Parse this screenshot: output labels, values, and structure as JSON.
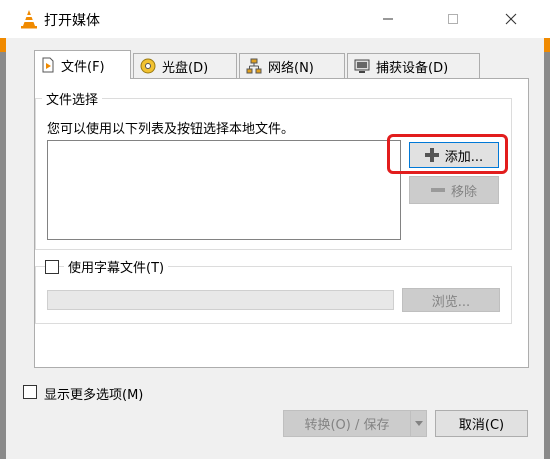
{
  "window": {
    "title": "打开媒体",
    "app_icon": "vlc-cone-icon",
    "controls": {
      "minimize_icon": "minimize-icon",
      "maximize_icon": "maximize-icon",
      "close_icon": "close-icon"
    }
  },
  "tabs": [
    {
      "label": "文件(F)",
      "icon": "file-icon",
      "active": true
    },
    {
      "label": "光盘(D)",
      "icon": "disc-icon",
      "active": false
    },
    {
      "label": "网络(N)",
      "icon": "network-icon",
      "active": false
    },
    {
      "label": "捕获设备(D)",
      "icon": "capture-device-icon",
      "active": false
    }
  ],
  "file_selection": {
    "group_label": "文件选择",
    "description": "您可以使用以下列表及按钮选择本地文件。",
    "add_button": "添加...",
    "remove_button": "移除"
  },
  "subtitle": {
    "checkbox_label": "使用字幕文件(T)",
    "checked": false,
    "path_value": "",
    "browse_button": "浏览..."
  },
  "footer": {
    "more_options_label": "显示更多选项(M)",
    "more_options_checked": false,
    "convert_save_button": "转换(O) / 保存",
    "cancel_button": "取消(C)"
  },
  "colors": {
    "vlc_orange": "#f08a00",
    "highlight_red": "#e21d1d",
    "focus_blue": "#0078d7"
  }
}
